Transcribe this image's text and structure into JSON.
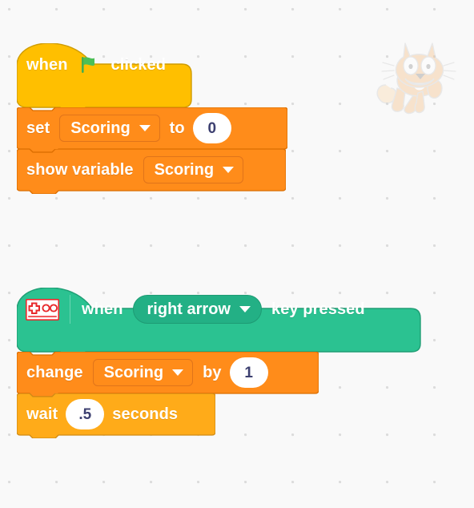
{
  "workspace": {
    "background_color": "#f9f9f9",
    "dot_color": "#dcdcdc",
    "watermark_icon": "scratch-cat-watermark"
  },
  "palette": {
    "events_yellow": "#ffbf00",
    "events_yellow_border": "#cf9c00",
    "events_green": "#2bc291",
    "events_green_border": "#1f9e74",
    "variables_orange": "#ff8c1a",
    "variables_orange_border": "#db6e00",
    "control_orange": "#ffab19",
    "control_orange_border": "#cf8b17",
    "input_text": "#3d4070",
    "flag_green": "#4cbf56"
  },
  "scripts": [
    {
      "id": "script-green-flag",
      "blocks": [
        {
          "id": "when-flag-clicked",
          "type": "hat",
          "category": "events",
          "label_before": "when",
          "icon": "green-flag-icon",
          "label_after": "clicked"
        },
        {
          "id": "set-variable-to",
          "type": "stack",
          "category": "variables",
          "label_before": "set",
          "dropdown": {
            "name": "variable-dropdown",
            "value": "Scoring"
          },
          "label_middle": "to",
          "input": {
            "name": "value-input",
            "value": "0"
          }
        },
        {
          "id": "show-variable",
          "type": "stack",
          "category": "variables",
          "label_before": "show variable",
          "dropdown": {
            "name": "variable-dropdown",
            "value": "Scoring"
          }
        }
      ]
    },
    {
      "id": "script-key-pressed",
      "blocks": [
        {
          "id": "when-key-pressed",
          "type": "hat",
          "category": "events-green",
          "icon": "gamepad-icon",
          "label_before": "when",
          "dropdown": {
            "name": "key-dropdown",
            "value": "right arrow"
          },
          "label_after": "key pressed"
        },
        {
          "id": "change-variable-by",
          "type": "stack",
          "category": "variables",
          "label_before": "change",
          "dropdown": {
            "name": "variable-dropdown",
            "value": "Scoring"
          },
          "label_middle": "by",
          "input": {
            "name": "amount-input",
            "value": "1"
          }
        },
        {
          "id": "wait-seconds",
          "type": "stack",
          "category": "control",
          "label_before": "wait",
          "input": {
            "name": "duration-input",
            "value": ".5"
          },
          "label_after": "seconds"
        }
      ]
    }
  ]
}
